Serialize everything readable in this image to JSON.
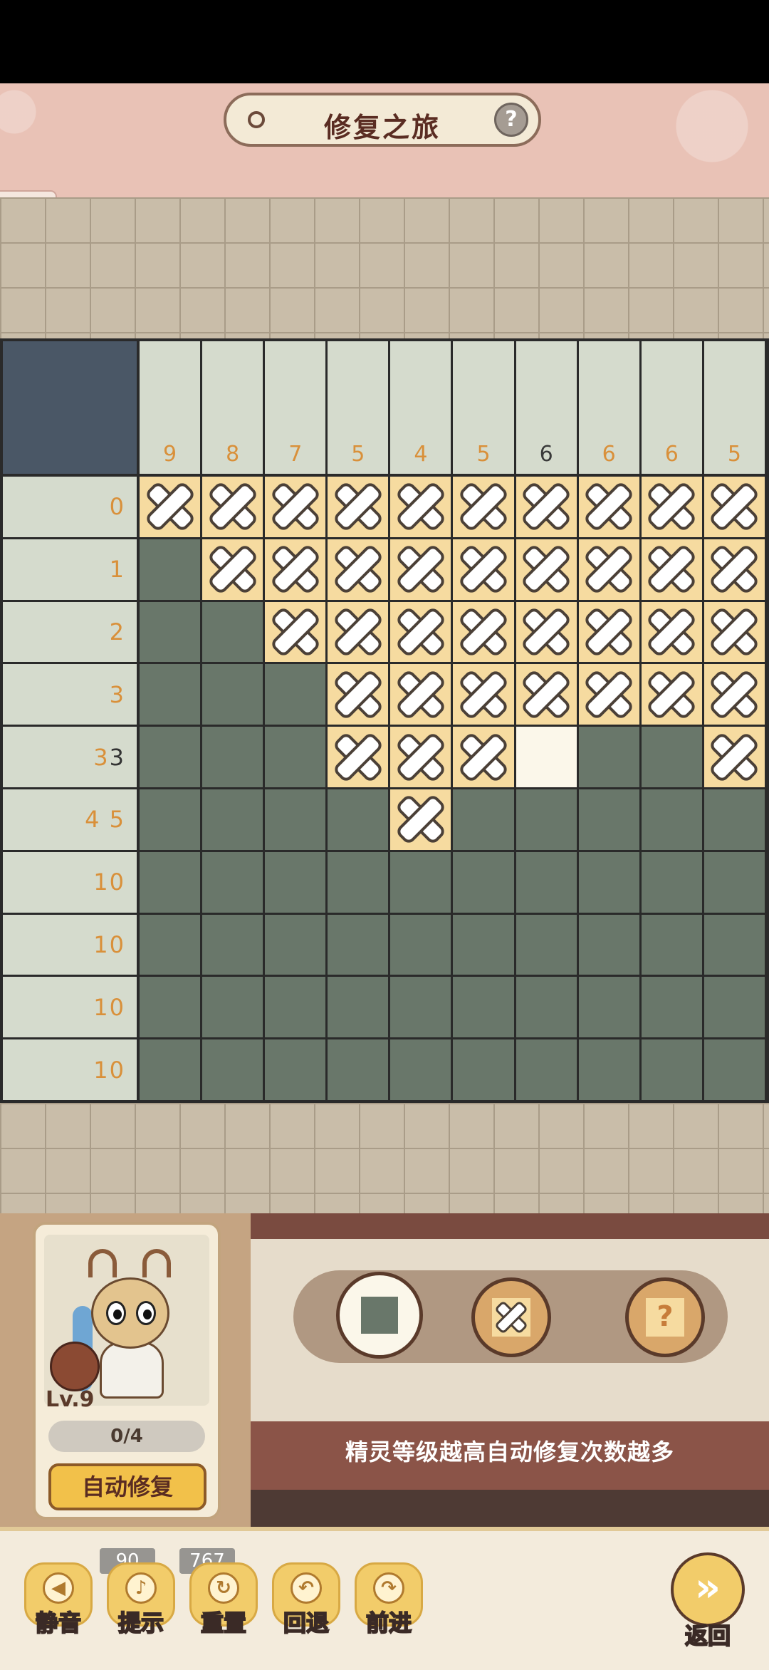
{
  "header": {
    "title": "修复之旅",
    "help_icon": "question-icon"
  },
  "puzzle": {
    "column_clues": [
      {
        "text": "9",
        "done": false
      },
      {
        "text": "8",
        "done": false
      },
      {
        "text": "7",
        "done": false
      },
      {
        "text": "5",
        "done": false
      },
      {
        "text": "4",
        "done": false
      },
      {
        "text": "5",
        "done": false
      },
      {
        "text": "6",
        "done": true
      },
      {
        "text": "6",
        "done": false
      },
      {
        "text": "6",
        "done": false
      },
      {
        "text": "5",
        "done": false
      }
    ],
    "row_clues": [
      {
        "first": "0",
        "rest": ""
      },
      {
        "first": "1",
        "rest": ""
      },
      {
        "first": "2",
        "rest": ""
      },
      {
        "first": "3",
        "rest": ""
      },
      {
        "first": "3",
        "rest": "3"
      },
      {
        "first": "4 5",
        "rest": ""
      },
      {
        "first": "10",
        "rest": ""
      },
      {
        "first": "10",
        "rest": ""
      },
      {
        "first": "10",
        "rest": ""
      },
      {
        "first": "10",
        "rest": ""
      }
    ],
    "grid": [
      "XXXXXXXXXX",
      "FXXXXXXXXX",
      "FFXXXXXXXX",
      "FFFXXXXXXX",
      "FFFXXXEFFX",
      "FFFFXFFFFF",
      "FFFFFFFFFF",
      "FFFFFFFFFF",
      "FFFFFFFFFF",
      "FFFFFFFFFF"
    ],
    "colors": {
      "filled": "#69776a",
      "cross": "#f6dba0",
      "empty": "#fbf7ea",
      "clue": "#d9903a"
    }
  },
  "sprite": {
    "level": "Lv.9",
    "repairs": "0/4",
    "auto_repair_label": "自动修复"
  },
  "tools": {
    "fill": "fill-tool",
    "cross": "cross-tool",
    "hint": "?",
    "tip": "精灵等级越高自动修复次数越多"
  },
  "bottom": {
    "mute_label": "静音",
    "hint_label": "提示",
    "hint_count": "90",
    "reset_label": "重置",
    "reset_count": "767",
    "undo_label": "回退",
    "redo_label": "前进",
    "back_label": "返回"
  }
}
